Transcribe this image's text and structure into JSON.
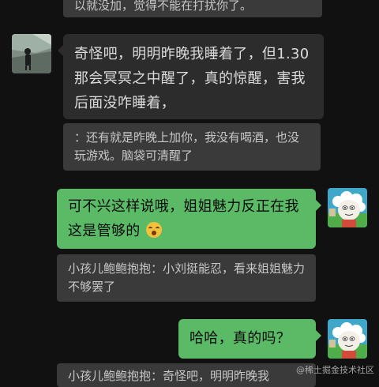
{
  "messages": {
    "top_quote_partial": "以就没加，觉得不能在打扰你了。",
    "incoming_1": "奇怪吧，明明昨晚我睡着了，但1.30那会冥冥之中醒了，真的惊醒，害我后面没咋睡着，",
    "quote_1": "：还有就是昨晚上加你，我没有喝酒，也没玩游戏。脑袋可清醒了",
    "outgoing_1": "可不兴这样说哦，姐姐魅力反正在我这是管够的",
    "quote_2": "小孩儿鲍鲍抱抱：小刘挺能忍，看来姐姐魅力不够罢了",
    "outgoing_2": "哈哈，真的吗？",
    "bottom_quote_partial": "小孩儿鲍鲍抱抱：奇怪吧，明明昨晚我"
  },
  "watermark": "@稀土掘金技术社区",
  "icons": {
    "left_avatar": "person-photo-avatar",
    "right_avatar": "cartoon-sheep-avatar",
    "emoji": "face-emoji"
  },
  "colors": {
    "background": "#111111",
    "incoming_bubble": "#2c2c2c",
    "outgoing_bubble": "#5aba66",
    "quote_box": "#3a3a3a"
  }
}
